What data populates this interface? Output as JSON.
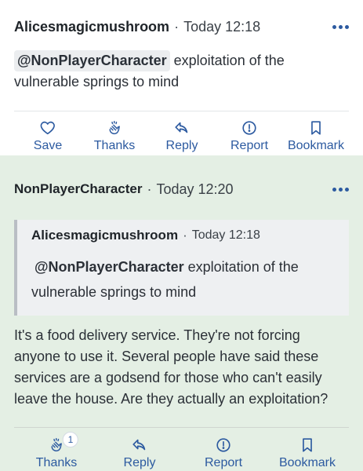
{
  "post1": {
    "author": "Alicesmagicmushroom",
    "separator": "·",
    "time": "Today 12:18",
    "mention": "@NonPlayerCharacter",
    "text_after_mention": " exploitation of the vulnerable springs to mind",
    "actions": [
      {
        "label": "Save",
        "icon": "heart-icon"
      },
      {
        "label": "Thanks",
        "icon": "clap-icon"
      },
      {
        "label": "Reply",
        "icon": "reply-icon"
      },
      {
        "label": "Report",
        "icon": "report-icon"
      },
      {
        "label": "Bookmark",
        "icon": "bookmark-icon"
      }
    ]
  },
  "post2": {
    "author": "NonPlayerCharacter",
    "separator": "·",
    "time": "Today 12:20",
    "quote": {
      "author": "Alicesmagicmushroom",
      "separator": "·",
      "time": "Today 12:18",
      "mention": "@NonPlayerCharacter",
      "text_after_mention": " exploitation of the vulnerable springs to mind"
    },
    "text": "It's a food delivery service. They're not forcing anyone to use it. Several people have said these services are a godsend for those who can't easily leave the house. Are they actually an exploitation?",
    "actions": [
      {
        "label": "Thanks",
        "icon": "clap-icon",
        "badge": "1"
      },
      {
        "label": "Reply",
        "icon": "reply-icon"
      },
      {
        "label": "Report",
        "icon": "report-icon"
      },
      {
        "label": "Bookmark",
        "icon": "bookmark-icon"
      }
    ]
  },
  "colors": {
    "accent": "#2c5aa0",
    "highlight_background": "#e4efe4",
    "quote_background": "#eef0f2"
  }
}
